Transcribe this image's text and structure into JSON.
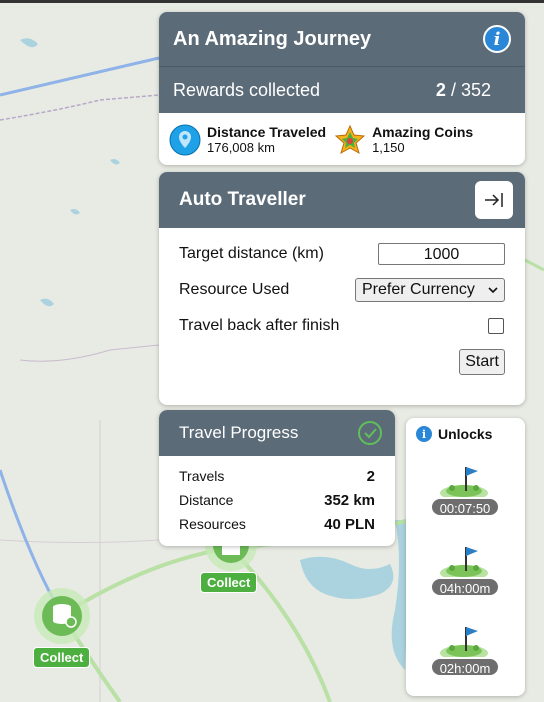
{
  "journey": {
    "title": "An Amazing Journey",
    "rewards_label": "Rewards collected",
    "rewards_collected": "2",
    "rewards_total": "352",
    "distance_label": "Distance Traveled",
    "distance_value": "176,008 km",
    "coins_label": "Amazing Coins",
    "coins_value": "1,150"
  },
  "auto_traveller": {
    "title": "Auto Traveller",
    "target_label": "Target distance (km)",
    "target_value": "1000",
    "resource_label": "Resource Used",
    "resource_value": "Prefer Currency",
    "travel_back_label": "Travel back after finish",
    "travel_back_checked": false,
    "start_label": "Start"
  },
  "progress": {
    "title": "Travel Progress",
    "rows": [
      {
        "label": "Travels",
        "value": "2"
      },
      {
        "label": "Distance",
        "value": "352 km"
      },
      {
        "label": "Resources",
        "value": "40 PLN"
      }
    ]
  },
  "unlocks": {
    "title": "Unlocks",
    "items": [
      {
        "time": "00:07:50"
      },
      {
        "time": "04h:00m"
      },
      {
        "time": "02h:00m"
      }
    ]
  },
  "map": {
    "collect_labels": [
      "Collect",
      "Collect"
    ]
  },
  "colors": {
    "header": "#5b6b78",
    "info": "#2a86d6",
    "success": "#4caf3f"
  }
}
